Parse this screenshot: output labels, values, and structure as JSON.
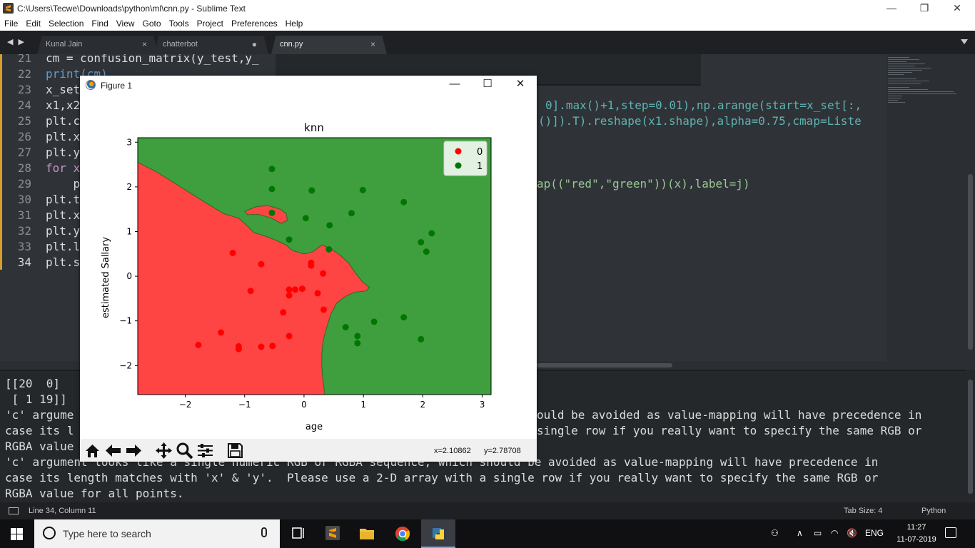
{
  "window": {
    "title": "C:\\Users\\Tecwe\\Downloads\\python\\ml\\cnn.py - Sublime Text",
    "minimize": "—",
    "maximize": "❐",
    "close": "✕"
  },
  "menu": [
    "File",
    "Edit",
    "Selection",
    "Find",
    "View",
    "Goto",
    "Tools",
    "Project",
    "Preferences",
    "Help"
  ],
  "tabs": [
    {
      "label": "Kunal Jain",
      "close": "×"
    },
    {
      "label": "chatterbot",
      "close": "●"
    },
    {
      "label": "cnn.py",
      "close": "×"
    }
  ],
  "editor": {
    "line_numbers": [
      "21",
      "22",
      "23",
      "24",
      "25",
      "26",
      "27",
      "28",
      "29",
      "30",
      "31",
      "32",
      "33",
      "34"
    ],
    "line_fragments": {
      "l21": "cm = confusion_matrix(y_test,y_",
      "l22": "print(cm)",
      "l23": "x_set",
      "l24": "x1,x2",
      "l25": "plt.c",
      "l26": "plt.x",
      "l27": "plt.y",
      "l28": "for x",
      "l29": "    p",
      "l30": "plt.t",
      "l31": "plt.x",
      "l32": "plt.y",
      "l33": "plt.l",
      "l34": "plt.s"
    },
    "right_fragments": {
      "r24": "0].max()+1,step=0.01),np.arange(start=x_set[:,",
      "r25": "()]).T).reshape(x1.shape),alpha=0.75,cmap=Liste",
      "r29": "ap((\"red\",\"green\"))(x),label=j)"
    }
  },
  "console": {
    "lines": [
      "[[20  0]",
      " [ 1 19]]",
      "'c' argume",
      "case its l",
      "RGBA value",
      "'c' argument looks like a single numeric RGB or RGBA sequence, which should be avoided as value-mapping will have precedence in",
      "case its length matches with 'x' & 'y'.  Please use a 2-D array with a single row if you really want to specify the same RGB or",
      "RGBA value for all points."
    ],
    "right_lines": [
      "ould be avoided as value-mapping will have precedence in",
      "single row if you really want to specify the same RGB or"
    ]
  },
  "statusbar": {
    "position": "Line 34, Column 11",
    "tab_size": "Tab Size: 4",
    "syntax": "Python"
  },
  "figure": {
    "title": "Figure 1",
    "minimize": "—",
    "maximize": "☐",
    "close": "✕",
    "coord_x": "x=2.10862",
    "coord_y": "y=2.78708",
    "toolbar": [
      "home-icon",
      "back-arrow-icon",
      "forward-arrow-icon",
      "pan-icon",
      "zoom-icon",
      "configure-icon",
      "save-icon"
    ]
  },
  "chart_data": {
    "type": "scatter",
    "title": "knn",
    "xlabel": "age",
    "ylabel": "estimated Sallary",
    "xlim": [
      -2.8,
      3.15
    ],
    "ylim": [
      -2.65,
      3.1
    ],
    "xticks": [
      "−2",
      "−1",
      "0",
      "1",
      "2",
      "3"
    ],
    "xtick_values": [
      -2,
      -1,
      0,
      1,
      2,
      3
    ],
    "yticks": [
      "−2",
      "−1",
      "0",
      "1",
      "2",
      "3"
    ],
    "ytick_values": [
      -2,
      -1,
      0,
      1,
      2,
      3
    ],
    "legend_position": "top-right",
    "background_regions": {
      "class_0_color": "#ff4444",
      "class_1_color": "#3f9f3f",
      "boundary_line_color": "#2a6a2a"
    },
    "series": [
      {
        "name": "0",
        "color": "#ff0000",
        "points": [
          [
            -1.2,
            0.52
          ],
          [
            -0.72,
            0.27
          ],
          [
            -0.9,
            -0.33
          ],
          [
            -0.25,
            -0.3
          ],
          [
            -0.25,
            -0.43
          ],
          [
            -0.15,
            -0.3
          ],
          [
            -0.03,
            -0.28
          ],
          [
            0.12,
            0.3
          ],
          [
            0.12,
            0.24
          ],
          [
            0.32,
            0.06
          ],
          [
            0.23,
            -0.38
          ],
          [
            0.33,
            -0.75
          ],
          [
            -0.35,
            -0.81
          ],
          [
            -1.4,
            -1.26
          ],
          [
            -0.25,
            -1.34
          ],
          [
            -1.78,
            -1.54
          ],
          [
            -1.1,
            -1.57
          ],
          [
            -1.1,
            -1.63
          ],
          [
            -0.72,
            -1.58
          ],
          [
            -0.53,
            -1.56
          ]
        ]
      },
      {
        "name": "1",
        "color": "#007700",
        "points": [
          [
            -0.54,
            2.4
          ],
          [
            -0.54,
            1.95
          ],
          [
            0.13,
            1.92
          ],
          [
            0.99,
            1.93
          ],
          [
            1.68,
            1.66
          ],
          [
            -0.54,
            1.42
          ],
          [
            0.03,
            1.3
          ],
          [
            0.8,
            1.41
          ],
          [
            0.43,
            1.14
          ],
          [
            2.15,
            0.96
          ],
          [
            -0.25,
            0.82
          ],
          [
            0.42,
            0.6
          ],
          [
            1.97,
            0.76
          ],
          [
            2.06,
            0.55
          ],
          [
            1.68,
            -0.92
          ],
          [
            1.18,
            -1.02
          ],
          [
            0.7,
            -1.14
          ],
          [
            0.9,
            -1.34
          ],
          [
            0.9,
            -1.5
          ],
          [
            1.97,
            -1.41
          ]
        ]
      }
    ]
  },
  "taskbar": {
    "search_placeholder": "Type here to search",
    "time": "11:27",
    "date": "11-07-2019",
    "language": "ENG"
  }
}
